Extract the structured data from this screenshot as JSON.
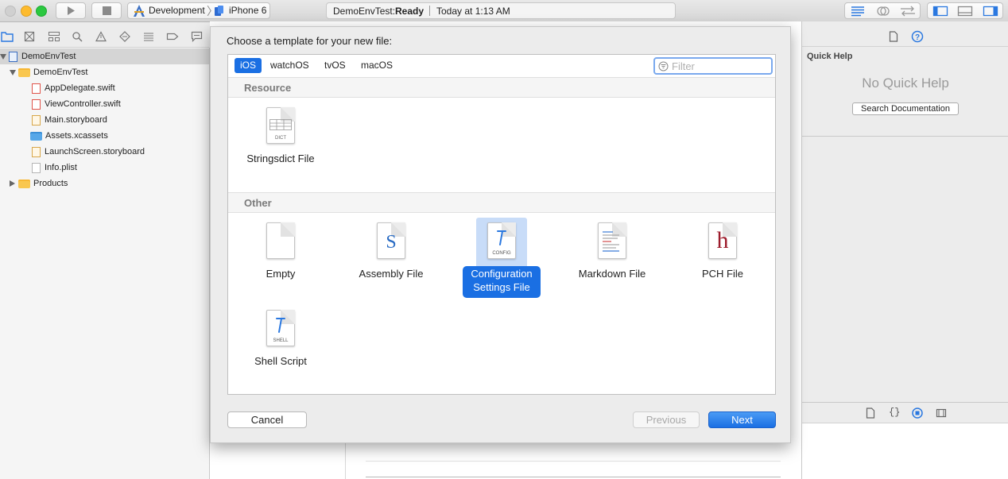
{
  "toolbar": {
    "scheme_name": "Development",
    "device_name": "iPhone 6",
    "activity_project": "DemoEnvTest:",
    "activity_status": "Ready",
    "activity_time": "Today at 1:13 AM"
  },
  "navigator": {
    "items": [
      {
        "label": "DemoEnvTest"
      },
      {
        "label": "DemoEnvTest"
      },
      {
        "label": "AppDelegate.swift"
      },
      {
        "label": "ViewController.swift"
      },
      {
        "label": "Main.storyboard"
      },
      {
        "label": "Assets.xcassets"
      },
      {
        "label": "LaunchScreen.storyboard"
      },
      {
        "label": "Info.plist"
      },
      {
        "label": "Products"
      }
    ]
  },
  "sheet": {
    "title": "Choose a template for your new file:",
    "tabs": [
      {
        "label": "iOS"
      },
      {
        "label": "watchOS"
      },
      {
        "label": "tvOS"
      },
      {
        "label": "macOS"
      }
    ],
    "filter_placeholder": "Filter",
    "sections": [
      {
        "title": "Resource"
      },
      {
        "title": "Other"
      }
    ],
    "templates": {
      "stringsdict": {
        "label": "Stringsdict File",
        "badge": "DICT"
      },
      "empty": {
        "label": "Empty"
      },
      "assembly": {
        "label": "Assembly File",
        "glyph": "S"
      },
      "config": {
        "label_line1": "Configuration",
        "label_line2": "Settings File",
        "badge": "CONFIG"
      },
      "markdown": {
        "label": "Markdown File"
      },
      "pch": {
        "label": "PCH File",
        "glyph": "h"
      },
      "shell": {
        "label": "Shell Script",
        "badge": "SHELL"
      }
    },
    "cancel_label": "Cancel",
    "previous_label": "Previous",
    "next_label": "Next"
  },
  "inspector": {
    "section_title": "Quick Help",
    "no_help": "No Quick Help",
    "search_label": "Search Documentation"
  },
  "colors": {
    "accent": "#1a6fe3",
    "selection_bg": "#c8dcf8"
  }
}
